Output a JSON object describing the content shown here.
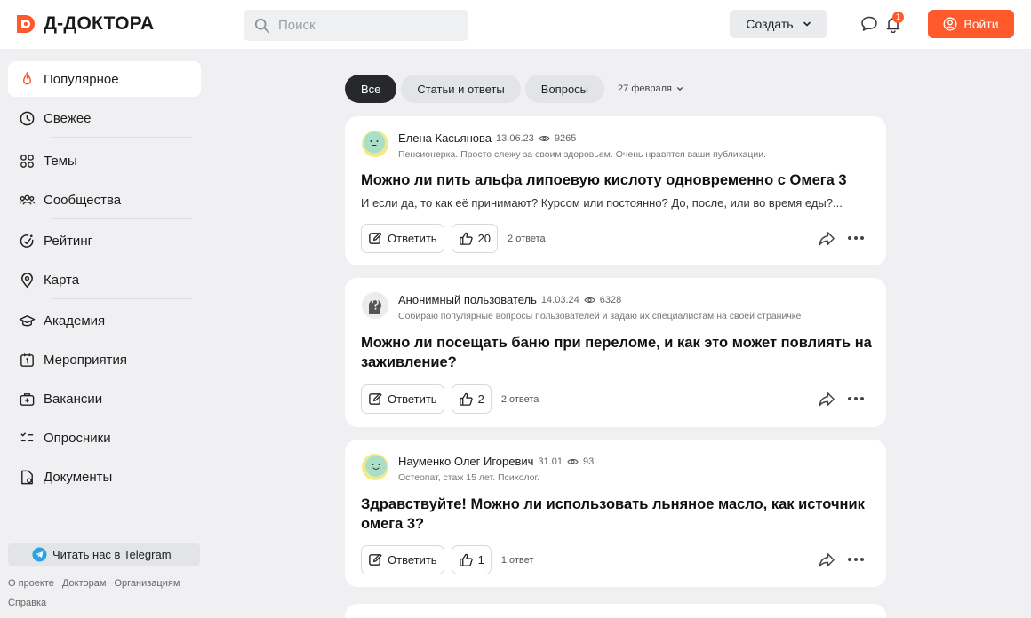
{
  "header": {
    "logo_text": "Д-ДОКТОРА",
    "search_placeholder": "Поиск",
    "create_label": "Создать",
    "notifications_count": "1",
    "login_label": "Войти",
    "accent_color": "#ff5a2c"
  },
  "sidebar": {
    "items": [
      {
        "label": "Популярное",
        "icon": "fire-icon"
      },
      {
        "label": "Свежее",
        "icon": "clock-icon"
      },
      {
        "label": "Темы",
        "icon": "grid-icon"
      },
      {
        "label": "Сообщества",
        "icon": "users-icon"
      },
      {
        "label": "Рейтинг",
        "icon": "rating-icon"
      },
      {
        "label": "Карта",
        "icon": "map-pin-icon"
      },
      {
        "label": "Академия",
        "icon": "graduation-cap-icon"
      },
      {
        "label": "Мероприятия",
        "icon": "calendar-icon"
      },
      {
        "label": "Вакансии",
        "icon": "briefcase-icon"
      },
      {
        "label": "Опросники",
        "icon": "survey-icon"
      },
      {
        "label": "Документы",
        "icon": "document-icon"
      }
    ],
    "telegram_label": "Читать нас в Telegram",
    "footer_links": [
      "О проекте",
      "Докторам",
      "Организациям",
      "Справка"
    ]
  },
  "tabs": {
    "items": [
      "Все",
      "Статьи и ответы",
      "Вопросы"
    ],
    "active": "Все",
    "date_filter": "27 февраля"
  },
  "posts": [
    {
      "author": "Елена Касьянова",
      "date": "13.06.23",
      "views": "9265",
      "description": "Пенсионерка. Просто слежу за своим здоровьем. Очень нравятся ваши публикации.",
      "title": "Можно ли пить альфа липоевую кислоту одновременно с Омега 3",
      "excerpt": "И если да, то как её принимают? Курсом или постоянно? До, после, или во время еды?...",
      "reply_label": "Ответить",
      "likes": "20",
      "answers": "2 ответа"
    },
    {
      "author": "Анонимный пользователь",
      "date": "14.03.24",
      "views": "6328",
      "description": "Собираю популярные вопросы пользователей и задаю их специалистам на своей страничке",
      "title": "Можно ли посещать баню при переломе, и как это может повлиять на заживление?",
      "excerpt": "",
      "reply_label": "Ответить",
      "likes": "2",
      "answers": "2 ответа"
    },
    {
      "author": "Науменко Олег Игоревич",
      "date": "31.01",
      "views": "93",
      "description": "Остеопат, стаж 15 лет. Психолог.",
      "title": "Здравствуйте! Можно ли использовать льняное масло, как источник омега 3?",
      "excerpt": "",
      "reply_label": "Ответить",
      "likes": "1",
      "answers": "1 ответ"
    }
  ]
}
